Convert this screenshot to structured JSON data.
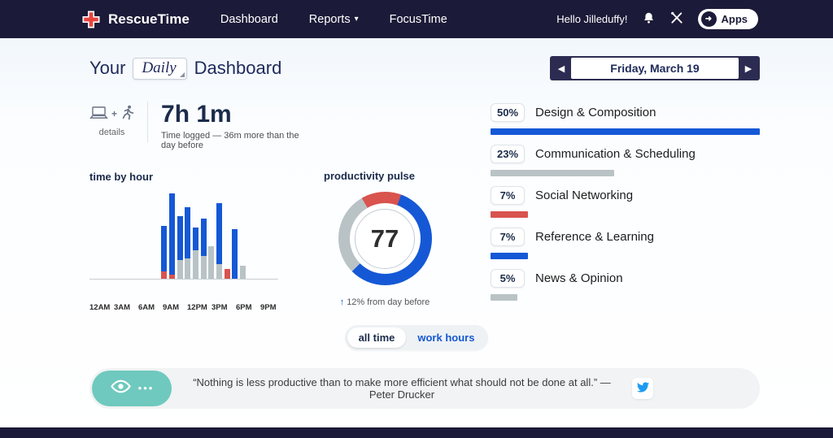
{
  "colors": {
    "navy": "#1b1a38",
    "blue": "#1558d6",
    "red": "#d9534f",
    "gray": "#b9c3c6",
    "teal": "#6fc9be"
  },
  "icons": {
    "caret": "▾",
    "prev": "◀",
    "next": "▶",
    "up_arrow": "↑",
    "dots": "•••",
    "plus": "+",
    "apps_arrow": "➜"
  },
  "header": {
    "brand": "RescueTime",
    "nav": [
      {
        "label": "Dashboard"
      },
      {
        "label": "Reports"
      },
      {
        "label": "FocusTime"
      }
    ],
    "greeting": "Hello Jilleduffy!",
    "apps_label": "Apps"
  },
  "title": {
    "prefix": "Your",
    "period": "Daily",
    "suffix": "Dashboard"
  },
  "date_nav": {
    "label": "Friday, March 19"
  },
  "summary": {
    "details_label": "details",
    "time_logged": "7h 1m",
    "subtitle": "Time logged — 36m more than the day before"
  },
  "chart_data": [
    {
      "type": "bar",
      "title": "time by hour",
      "stacked": true,
      "unit": "minutes",
      "ylim": [
        0,
        60
      ],
      "x_ticks": [
        "12AM",
        "3AM",
        "6AM",
        "9AM",
        "12PM",
        "3PM",
        "6PM",
        "9PM"
      ],
      "bars": [
        {
          "hour": 9,
          "distracting": 5,
          "neutral": 0,
          "productive": 32
        },
        {
          "hour": 10,
          "distracting": 3,
          "neutral": 0,
          "productive": 57
        },
        {
          "hour": 11,
          "distracting": 0,
          "neutral": 13,
          "productive": 31
        },
        {
          "hour": 12,
          "distracting": 0,
          "neutral": 14,
          "productive": 36
        },
        {
          "hour": 13,
          "distracting": 0,
          "neutral": 20,
          "productive": 16
        },
        {
          "hour": 14,
          "distracting": 0,
          "neutral": 16,
          "productive": 26
        },
        {
          "hour": 15,
          "distracting": 0,
          "neutral": 23,
          "productive": 0
        },
        {
          "hour": 16,
          "distracting": 0,
          "neutral": 10,
          "productive": 43
        },
        {
          "hour": 17,
          "distracting": 7,
          "neutral": 0,
          "productive": 0
        },
        {
          "hour": 18,
          "distracting": 0,
          "neutral": 0,
          "productive": 35
        },
        {
          "hour": 19,
          "distracting": 0,
          "neutral": 9,
          "productive": 0
        }
      ]
    },
    {
      "type": "donut",
      "title": "productivity pulse",
      "value": 77,
      "footnote": "12% from day before",
      "stops": [
        [
          "#d9534f",
          0,
          20
        ],
        [
          "#1558d6",
          20,
          225
        ],
        [
          "#b9c3c6",
          225,
          330
        ],
        [
          "#d9534f",
          330,
          360
        ]
      ],
      "legend": {
        "blue": "productive",
        "gray": "neutral",
        "red": "distracting"
      }
    },
    {
      "type": "bar",
      "title": "categories",
      "categories": [
        "Design & Composition",
        "Communication & Scheduling",
        "Social Networking",
        "Reference & Learning",
        "News & Opinion"
      ],
      "values": [
        50,
        23,
        7,
        7,
        5
      ]
    }
  ],
  "categories": [
    {
      "pct": "50%",
      "label": "Design & Composition",
      "color": "blue",
      "value": 50
    },
    {
      "pct": "23%",
      "label": "Communication & Scheduling",
      "color": "gray",
      "value": 23
    },
    {
      "pct": "7%",
      "label": "Social Networking",
      "color": "red",
      "value": 7
    },
    {
      "pct": "7%",
      "label": "Reference & Learning",
      "color": "blue",
      "value": 7
    },
    {
      "pct": "5%",
      "label": "News & Opinion",
      "color": "gray",
      "value": 5
    }
  ],
  "category_scale_max": 50,
  "toggle": {
    "options": [
      "all time",
      "work hours"
    ],
    "active": "all time"
  },
  "quote": {
    "text": "“Nothing is less productive than to make more efficient what should not be done at all.” — Peter Drucker"
  }
}
